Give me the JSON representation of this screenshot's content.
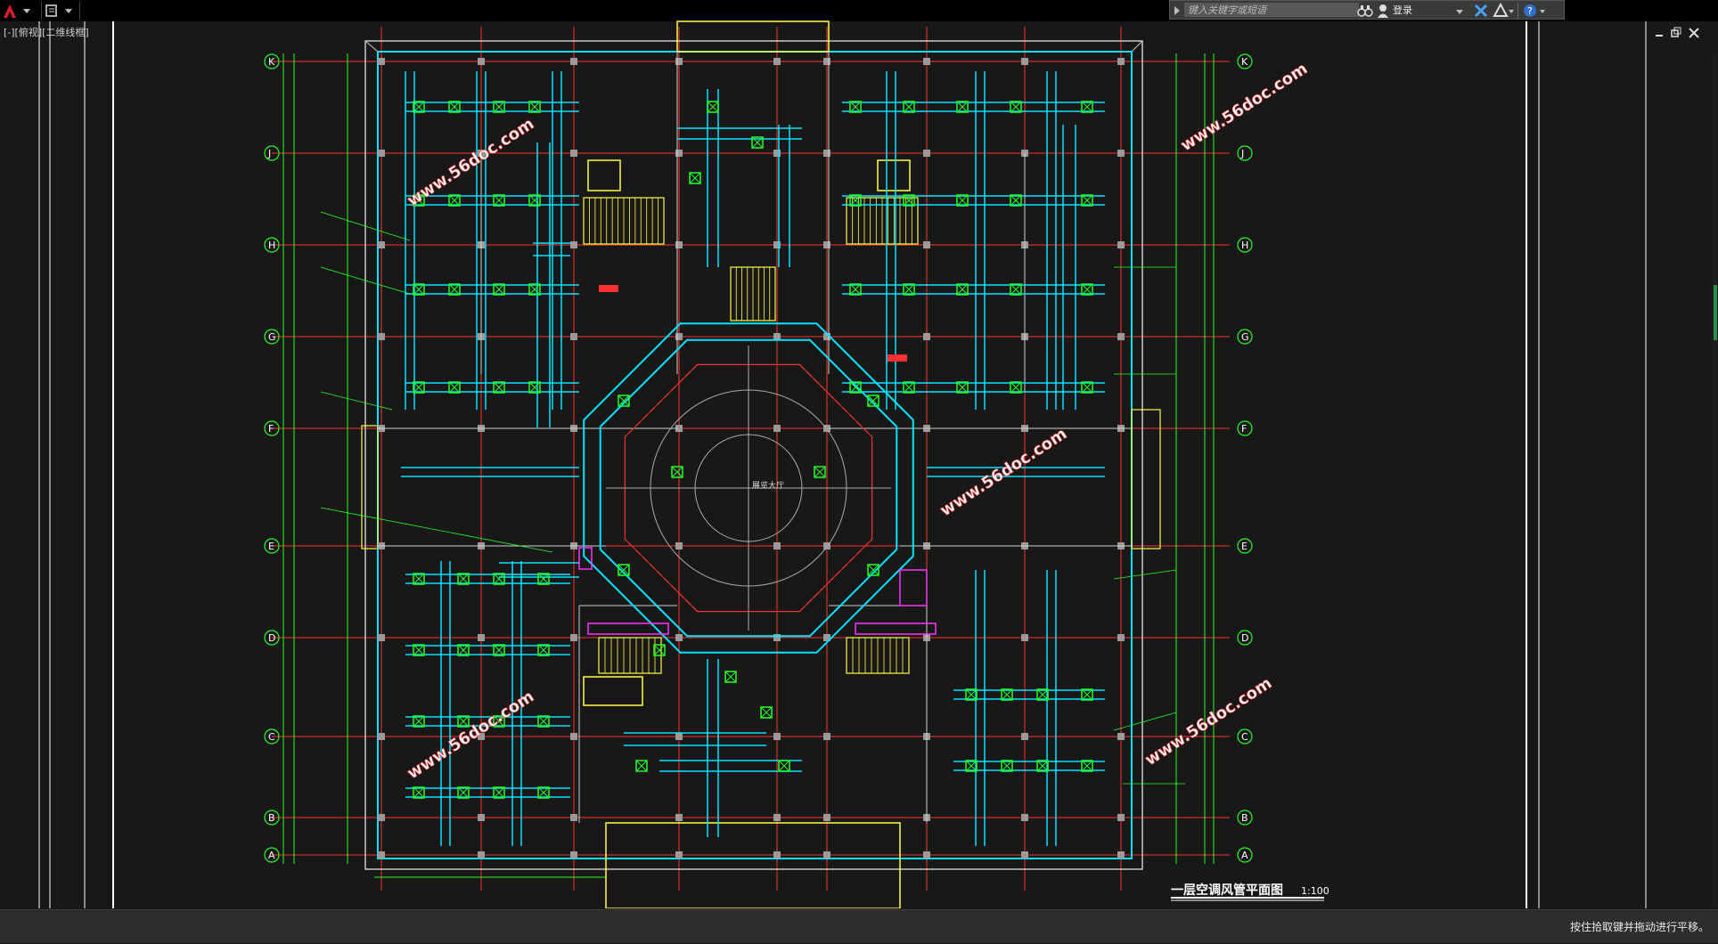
{
  "app": {
    "menu_icon": "autocad-logo-icon",
    "quick_access_icon": "workspace-dropdown-icon"
  },
  "search": {
    "placeholder": "键入关键字或短语",
    "login_label": "登录"
  },
  "viewport": {
    "label": "[-][俯视][二维线框]"
  },
  "drawing": {
    "title": "一层空调风管平面图",
    "scale": "1:100",
    "grid_rows": [
      "K",
      "J",
      "H",
      "G",
      "F",
      "E",
      "D",
      "C",
      "B",
      "A"
    ],
    "watermark": "www.56doc.com",
    "center_hall": "展览大厅",
    "colors": {
      "wall": "#ffffff",
      "duct": "#00e5ff",
      "diffuser": "#22ff22",
      "axis": "#ff3030",
      "dim": "#22ff22",
      "stair": "#ffff40",
      "equipment": "#ff30ff",
      "text": "#ffffff"
    }
  },
  "status": {
    "message": "按住拾取键并拖动进行平移。"
  }
}
